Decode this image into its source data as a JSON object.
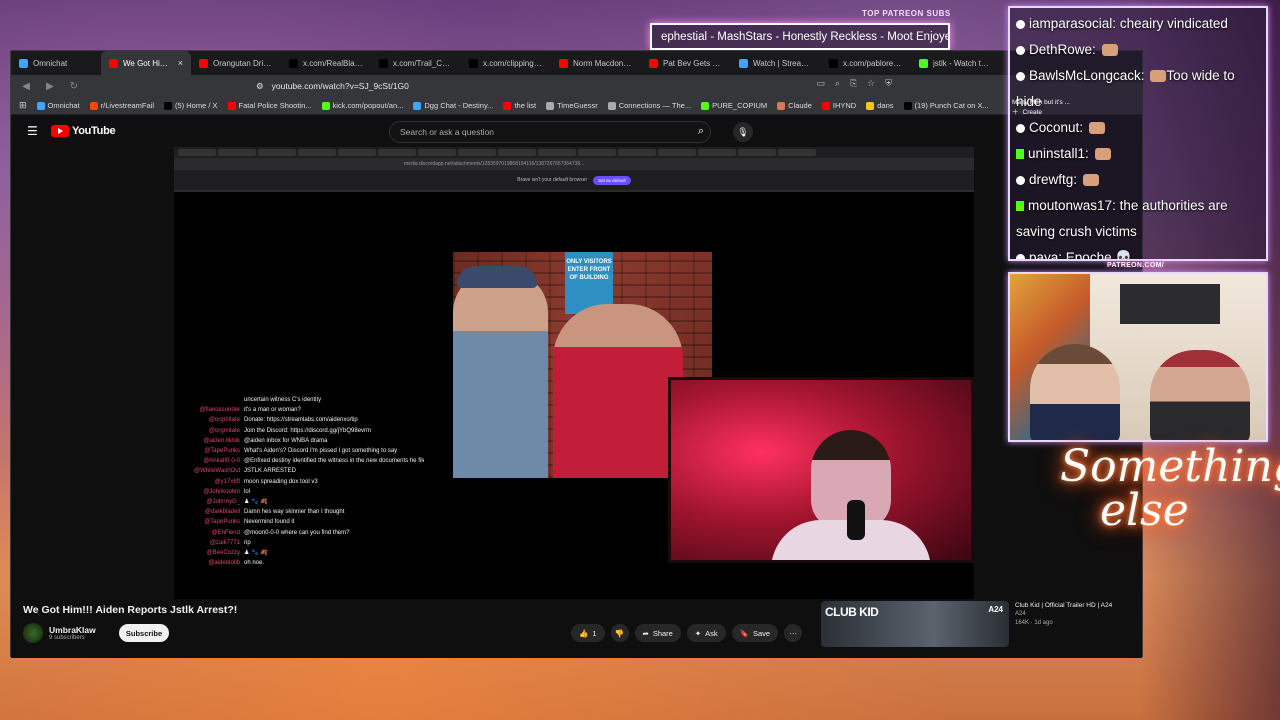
{
  "patreon": {
    "label": "TOP PATREON SUBS",
    "ticker": "ephestial - MashStars - Honestly Reckless - Moot Enjoye"
  },
  "tabs": [
    {
      "label": "Omnichat",
      "color": "#3ea6ff",
      "active": false
    },
    {
      "label": "We Got Him!!!",
      "color": "#ff0000",
      "active": true
    },
    {
      "label": "Orangutan Driving",
      "color": "#ff0000",
      "active": false
    },
    {
      "label": "x.com/RealBlackRei",
      "color": "#000000",
      "active": false
    },
    {
      "label": "x.com/Trail_Cams/",
      "color": "#000000",
      "active": false
    },
    {
      "label": "x.com/clippingwing",
      "color": "#000000",
      "active": false
    },
    {
      "label": "Norm Macdonald",
      "color": "#ff0000",
      "active": false
    },
    {
      "label": "Pat Bev Gets SHOC",
      "color": "#ff0000",
      "active": false
    },
    {
      "label": "Watch | Streamab",
      "color": "#3ea6ff",
      "active": false
    },
    {
      "label": "x.com/pabloreport",
      "color": "#000000",
      "active": false
    },
    {
      "label": "jstlk - Watch the V",
      "color": "#53fc18",
      "active": false
    }
  ],
  "toolbar": {
    "url": "youtube.com/watch?v=SJ_9cSt/1G0"
  },
  "bookmarks": [
    {
      "label": "Omnichat",
      "color": "#3ea6ff"
    },
    {
      "label": "r/LivestreamFail",
      "color": "#ff4500"
    },
    {
      "label": "(5) Home / X",
      "color": "#000000"
    },
    {
      "label": "Fatal Police Shootin...",
      "color": "#ff0000"
    },
    {
      "label": "kick.com/popout/an...",
      "color": "#53fc18"
    },
    {
      "label": "Dgg Chat - Destiny...",
      "color": "#3ea6ff"
    },
    {
      "label": "the list",
      "color": "#ff0000"
    },
    {
      "label": "TimeGuessr",
      "color": "#aaaaaa"
    },
    {
      "label": "Connections — The...",
      "color": "#aaaaaa"
    },
    {
      "label": "PURE_COPIUM",
      "color": "#53fc18"
    },
    {
      "label": "Claude",
      "color": "#d97757"
    },
    {
      "label": "IHYND",
      "color": "#ff0000"
    },
    {
      "label": "dans",
      "color": "#f5c518"
    },
    {
      "label": "(19) Punch Cat on X...",
      "color": "#000000"
    }
  ],
  "youtube": {
    "logo": "YouTube",
    "search_placeholder": "Search or ask a question",
    "video_title": "We Got Him!!! Aiden Reports Jstlk Arrest?!",
    "channel_name": "UmbraKlaw",
    "subscribers": "9 subscribers",
    "subscribe_label": "Subscribe",
    "likes": "1",
    "share_label": "Share",
    "ask_label": "Ask",
    "save_label": "Save"
  },
  "inner_browser": {
    "url": "media.discordapp.net/attachments/1283597019868194116/1387267657364738...",
    "notice": "Brave isn't your default browser",
    "notice_button": "Set as default"
  },
  "photo_sign": "ONLY VISITORS ENTER FRONT OF BUILDING",
  "video_chat": [
    {
      "user": "",
      "message": "uncertain witness C's identity"
    },
    {
      "user": "@fiancesunder",
      "message": "it's a man or woman?"
    },
    {
      "user": "@orgmitate",
      "message": "Donate: https://streamlabs.com/aidenxo/tip"
    },
    {
      "user": "@orgmitate",
      "message": "Join the Discord: https://discord.gg/jYbQ98evrm"
    },
    {
      "user": "@aiden.tiktok",
      "message": "@aiden inbox for WNBA drama"
    },
    {
      "user": "@TapePunks",
      "message": "What's Aiden's? Discord I'm pissed I got something to say"
    },
    {
      "user": "@Ankalt0-0-0",
      "message": "@Enfixed destiny identified the witness in the new documents he filed tonight"
    },
    {
      "user": "@WhiteWashOut",
      "message": "JSTLK ARRESTED"
    },
    {
      "user": "@y17x6ft",
      "message": "moon spreading dox tool v3"
    },
    {
      "user": "@Johnkoolen",
      "message": "lol"
    },
    {
      "user": "@JohnnyG_",
      "message": "♟ 🐾 🍂"
    },
    {
      "user": "@darkbladell",
      "message": "Damn hes way skinnier than I thought"
    },
    {
      "user": "@TapePunks",
      "message": "Nevermind found it"
    },
    {
      "user": "@EnFiend",
      "message": "@moon0-0-0 where can you find them?"
    },
    {
      "user": "@zaik7771",
      "message": "rip"
    },
    {
      "user": "@BeeCozzy",
      "message": "♟ 🐾 🍂"
    },
    {
      "user": "@aidentollb",
      "message": "oh noe."
    }
  ],
  "recommendation": {
    "thumb_text": "CLUB KID",
    "badge": "A24",
    "title": "Club Kid | Official Trailer HD | A24",
    "channel": "A24",
    "meta": "164K · 1d ago"
  },
  "chat_panel": [
    {
      "user": "iamparasocial",
      "message": "cheairy vindicated",
      "emote": false,
      "platform": "twitch"
    },
    {
      "user": "DethRowe",
      "message": "",
      "emote": true,
      "platform": "twitch"
    },
    {
      "user": "BawlsMcLongcack",
      "message": "Too wide to hide",
      "emote": true,
      "platform": "twitch"
    },
    {
      "user": "Coconut",
      "message": "",
      "emote": true,
      "platform": "twitch"
    },
    {
      "user": "uninstall1",
      "message": "",
      "emote": true,
      "platform": "kick"
    },
    {
      "user": "drewftg",
      "message": "",
      "emote": true,
      "platform": "twitch"
    },
    {
      "user": "moutonwas17",
      "message": "the authorities are saving crush victims",
      "emote": false,
      "platform": "kick"
    },
    {
      "user": "paya",
      "message": "Epoche 💀",
      "emote": false,
      "platform": "twitch"
    }
  ],
  "yt_menu": {
    "line1": "Many Men but it's ...",
    "create": "Create"
  },
  "cam_label": "PATREON.COM/",
  "neon_text": [
    "Something",
    "else"
  ]
}
